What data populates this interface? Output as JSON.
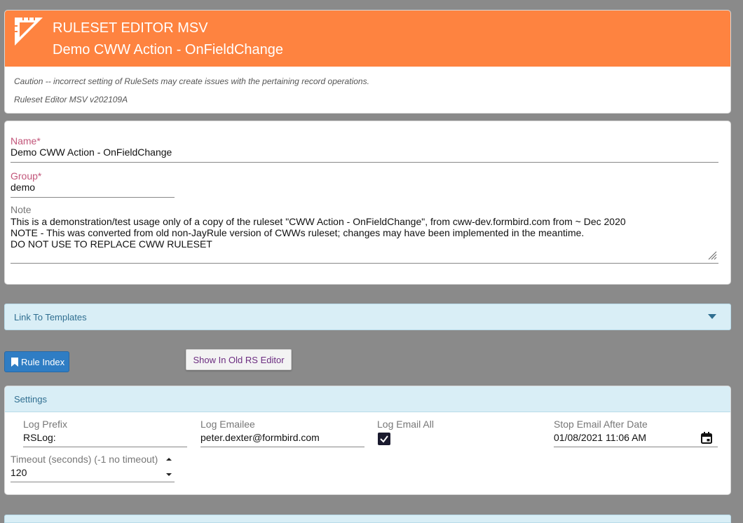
{
  "header": {
    "title": "RULESET EDITOR MSV",
    "subtitle": "Demo CWW Action - OnFieldChange",
    "caution": "Caution -- incorrect setting of RuleSets may create issues with the pertaining record operations.",
    "version": "Ruleset Editor MSV v202109A",
    "accent_color": "#fe8340"
  },
  "form": {
    "name_label": "Name",
    "name_value": "Demo CWW Action - OnFieldChange",
    "group_label": "Group",
    "group_value": "demo",
    "required_mark": "*",
    "note_label": "Note",
    "note_value": "This is a demonstration/test usage only of a copy of the ruleset \"CWW Action - OnFieldChange\", from cww-dev.formbird.com from ~ Dec 2020\nNOTE - This was converted from old non-JayRule version of CWWs ruleset; changes may have been implemented in the meantime.\nDO NOT USE TO REPLACE CWW RULESET"
  },
  "templates": {
    "label": "Link To Templates"
  },
  "buttons": {
    "rule_index": "Rule Index",
    "old_editor": "Show In Old RS Editor"
  },
  "settings": {
    "title": "Settings",
    "log_prefix_label": "Log Prefix",
    "log_prefix_value": "RSLog:",
    "log_emailee_label": "Log Emailee",
    "log_emailee_value": "peter.dexter@formbird.com",
    "log_email_all_label": "Log Email All",
    "log_email_all_checked": true,
    "stop_email_label": "Stop Email After Date",
    "stop_email_value": "01/08/2021 11:06 AM",
    "timeout_label": "Timeout (seconds) (-1 no timeout)",
    "timeout_value": "120"
  }
}
